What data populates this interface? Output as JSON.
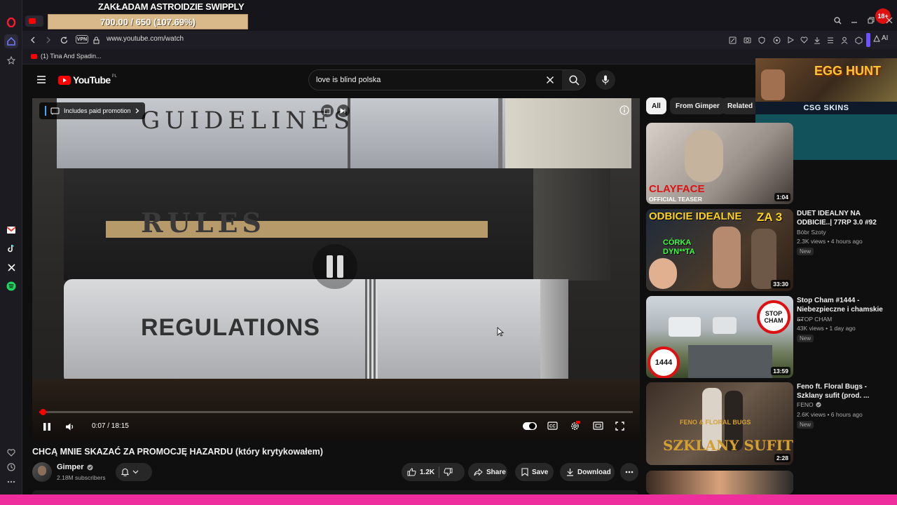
{
  "stream": {
    "title": "ZAKŁADAM ASTROIDZIE SWIPPLY",
    "progress_text": "700.00 / 650 (107.69%)",
    "progress_fraction": 1.0769
  },
  "browser": {
    "url": "www.youtube.com/watch",
    "vpn_label": "VPN",
    "bookmark": "(1) Tina And Spadin...",
    "notification_badge": "18+",
    "aria_label": "AI"
  },
  "youtube": {
    "logo": "YouTube",
    "region": "PL",
    "search_value": "love is blind polska",
    "player": {
      "paid_promotion": "Includes paid promotion",
      "time": "0:07 / 18:15",
      "progress_fraction": 0.0064,
      "book_labels": [
        "GUIDELINES",
        "RULES",
        "REGULATIONS"
      ]
    },
    "video": {
      "title": "CHCĄ MNIE SKAZAĆ ZA PROMOCJĘ HAZARDU (który krytykowałem)",
      "channel": "Gimper",
      "subscribers": "2.18M subscribers",
      "likes": "1.2K",
      "share": "Share",
      "save": "Save",
      "download": "Download"
    },
    "chips": [
      "All",
      "From Gimper",
      "Related"
    ],
    "ad": {
      "title": "EGG HUNT",
      "brand": "CSG SKINS"
    },
    "recommendations": [
      {
        "thumb_text": "CLAYFACE",
        "thumb_sub": "OFFICIAL TEASER",
        "duration": "1:04"
      },
      {
        "thumb_text": "ODBICIE IDEALNE",
        "thumb_sub": "CÓRKA DYN**TA",
        "thumb_extra": "ZA 3",
        "duration": "33:30",
        "title": "DUET IDEALNY NA ODBICIE..| 77RP 3.0 #92",
        "channel": "Bóbr Szoty",
        "meta": "2.3K views • 4 hours ago",
        "badge": "New"
      },
      {
        "thumb_text": "STOP CHAM",
        "thumb_sub": "1444",
        "duration": "13:59",
        "title": "Stop Cham #1444 - Niebezpieczne i chamskie ...",
        "channel": "STOP CHAM",
        "meta": "43K views • 1 day ago",
        "badge": "New"
      },
      {
        "thumb_text": "FENO & FLORAL BUGS",
        "thumb_sub": "SZKLANY SUFIT",
        "duration": "2:28",
        "title": "Feno ft. Floral Bugs - Szklany sufit (prod. ...",
        "channel": "FENO",
        "meta": "2.6K views • 6 hours ago",
        "badge": "New"
      }
    ]
  },
  "colors": {
    "youtube_red": "#ff0000",
    "opera_red": "#ff1b2d",
    "stream_pink": "#ef2e9e",
    "accent_blue": "#3ea6ff"
  }
}
